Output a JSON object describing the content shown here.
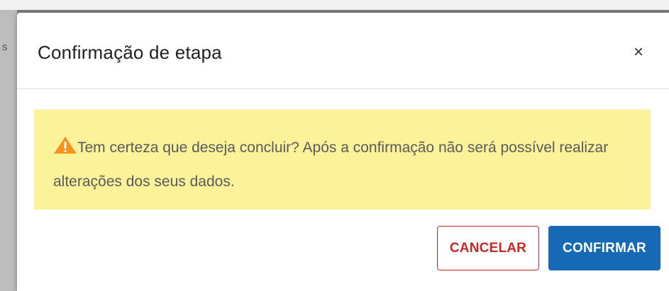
{
  "backdrop": {
    "partial_text": "s"
  },
  "dialog": {
    "title": "Confirmação de etapa",
    "close_label": "×",
    "alert": {
      "icon": "warning-triangle-icon",
      "message": "Tem certeza que deseja concluir? Após a confirmação não será possível realizar alterações dos seus dados.",
      "background": "#fbf29a",
      "icon_color": "#f7941d"
    },
    "buttons": {
      "cancel_label": "CANCELAR",
      "confirm_label": "CONFIRMAR"
    },
    "colors": {
      "cancel": "#c62828",
      "confirm": "#1669b4"
    }
  }
}
